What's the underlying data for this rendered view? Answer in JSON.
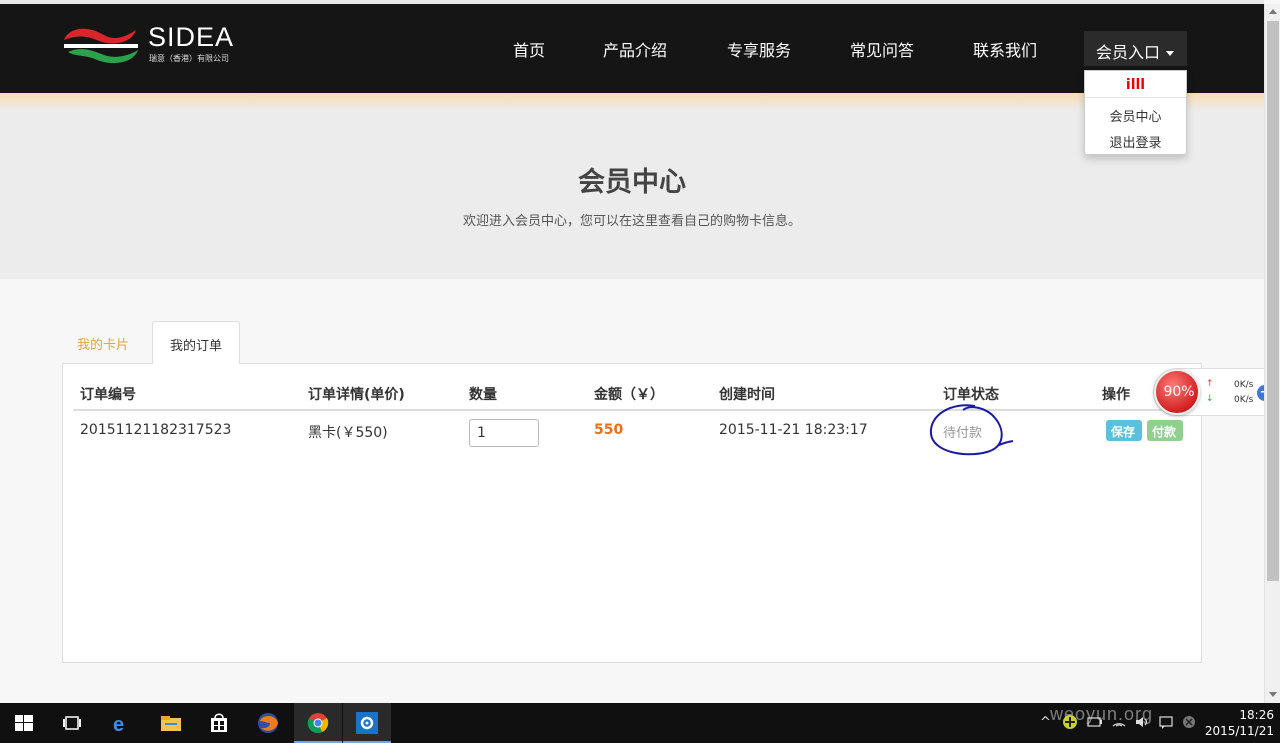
{
  "navbar": {
    "brand": "SIDEA",
    "brand_sub": "瑞意（香港）有限公司",
    "items": [
      "首页",
      "产品介绍",
      "专享服务",
      "常见问答",
      "联系我们"
    ],
    "member_label": "会员入口",
    "dropdown": {
      "username": "illl",
      "items": [
        "会员中心",
        "退出登录"
      ]
    }
  },
  "hero": {
    "title": "会员中心",
    "subtitle": "欢迎进入会员中心，您可以在这里查看自己的购物卡信息。"
  },
  "tabs": [
    "我的卡片",
    "我的订单"
  ],
  "table": {
    "headers": [
      "订单编号",
      "订单详情(单价)",
      "数量",
      "金额（￥）",
      "创建时间",
      "订单状态",
      "操作"
    ],
    "rows": [
      {
        "order_no": "20151121182317523",
        "detail": "黑卡(￥550)",
        "quantity": "1",
        "amount": "550",
        "created": "2015-11-21 18:23:17",
        "status": "待付款",
        "actions": [
          "保存",
          "付款"
        ]
      }
    ]
  },
  "speed_widget": {
    "percent": "90%",
    "up": "0K/s",
    "down": "0K/s"
  },
  "taskbar": {
    "time": "18:26",
    "date": "2015/11/21",
    "watermark": "weoyun.org"
  },
  "colors": {
    "navbar_bg": "#151515",
    "accent_orange": "#e8a33c",
    "amount_color": "#e8701a",
    "save_btn": "#5bc0de",
    "pay_btn": "#8fd08f",
    "annotation": "#1a1aa8"
  }
}
